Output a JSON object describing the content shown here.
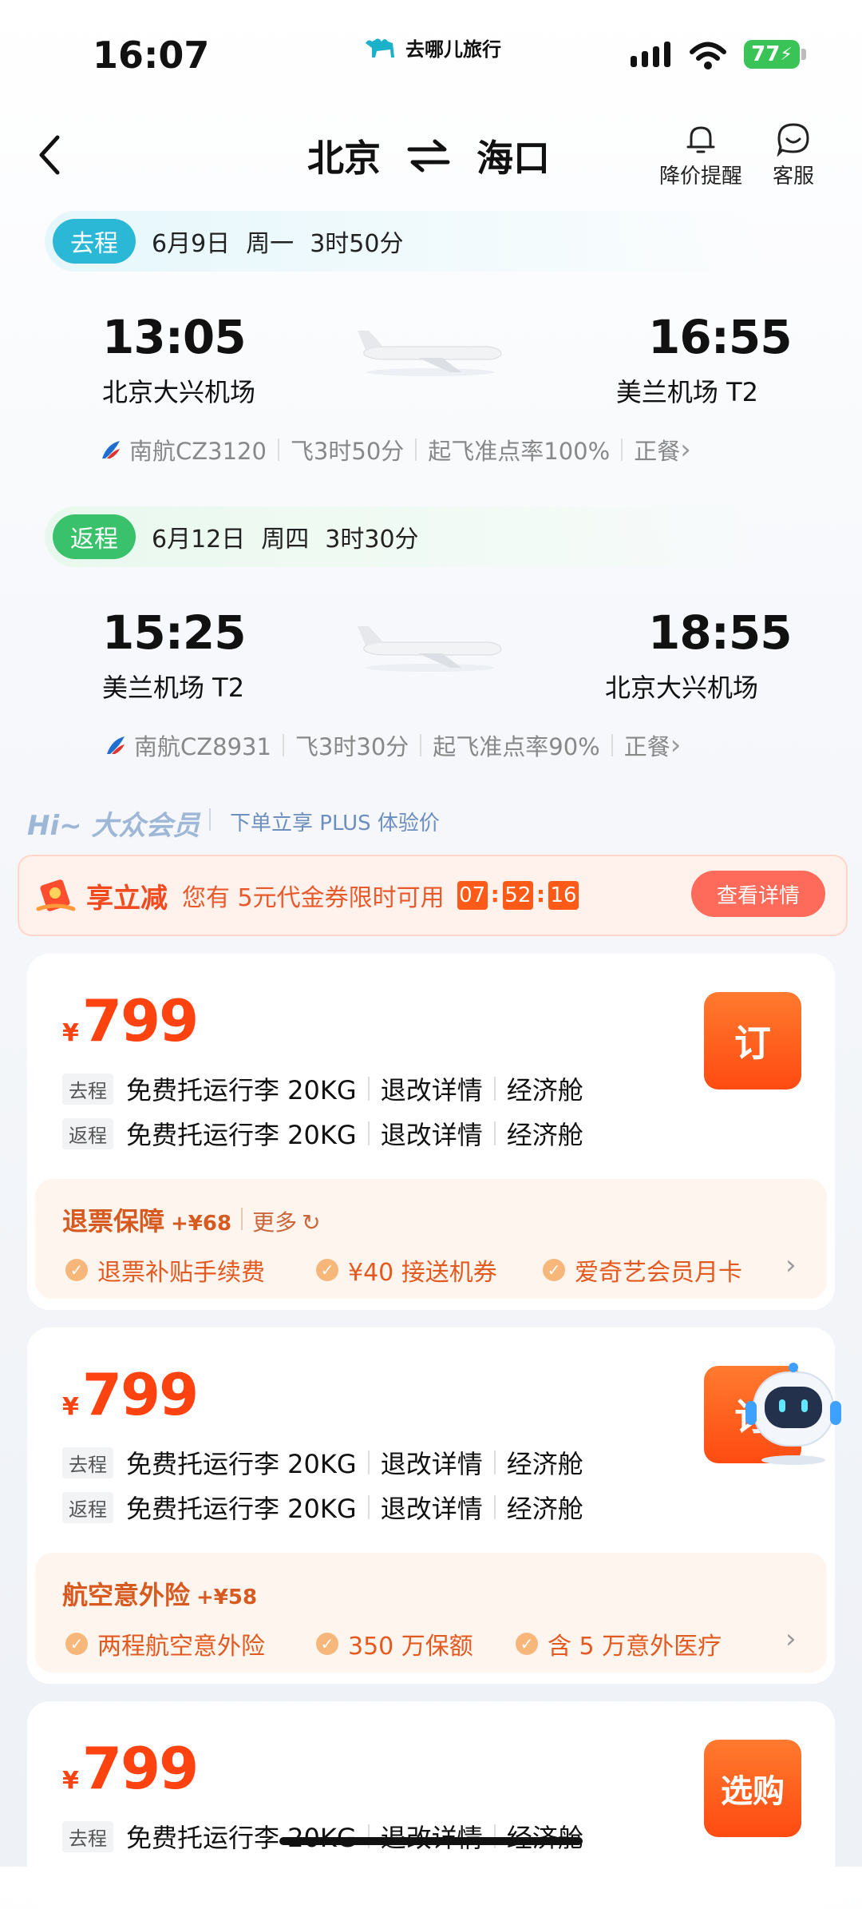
{
  "status": {
    "time": "16:07",
    "app_name": "去哪儿旅行",
    "battery": "77"
  },
  "header": {
    "from": "北京",
    "to": "海口",
    "price_alert": "降价提醒",
    "service": "客服"
  },
  "outbound": {
    "tag": "去程",
    "date": "6月9日",
    "weekday": "周一",
    "duration": "3时50分",
    "dep_time": "13:05",
    "dep_airport": "北京大兴机场",
    "arr_time": "16:55",
    "arr_airport": "美兰机场 T2",
    "flight": "南航CZ3120",
    "fly_time": "飞3时50分",
    "ontime": "起飞准点率100%",
    "meal": "正餐"
  },
  "return": {
    "tag": "返程",
    "date": "6月12日",
    "weekday": "周四",
    "duration": "3时30分",
    "dep_time": "15:25",
    "dep_airport": "美兰机场 T2",
    "arr_time": "18:55",
    "arr_airport": "北京大兴机场",
    "flight": "南航CZ8931",
    "fly_time": "飞3时30分",
    "ontime": "起飞准点率90%",
    "meal": "正餐"
  },
  "member": {
    "title": "Hi~ 大众会员",
    "subtitle": "下单立享 PLUS 体验价"
  },
  "coupon": {
    "title": "享立减",
    "text": "您有 5元代金券限时可用",
    "h": "07",
    "m": "52",
    "s": "16",
    "button": "查看详情"
  },
  "colors": {
    "accent": "#ff4310",
    "outbound_tag": "#2bb8d6",
    "return_tag": "#39c26b"
  },
  "cards": [
    {
      "currency": "¥",
      "price": "799",
      "button": "订",
      "rows": [
        {
          "tag": "去程",
          "baggage": "免费托运行李 20KG",
          "rules": "退改详情",
          "cabin": "经济舱"
        },
        {
          "tag": "返程",
          "baggage": "免费托运行李 20KG",
          "rules": "退改详情",
          "cabin": "经济舱"
        }
      ],
      "extra": {
        "title": "退票保障",
        "price": "+¥68",
        "more": "更多",
        "perks": [
          "退票补贴手续费",
          "¥40 接送机券",
          "爱奇艺会员月卡"
        ]
      }
    },
    {
      "currency": "¥",
      "price": "799",
      "button": "订",
      "rows": [
        {
          "tag": "去程",
          "baggage": "免费托运行李 20KG",
          "rules": "退改详情",
          "cabin": "经济舱"
        },
        {
          "tag": "返程",
          "baggage": "免费托运行李 20KG",
          "rules": "退改详情",
          "cabin": "经济舱"
        }
      ],
      "extra": {
        "title": "航空意外险",
        "price": "+¥58",
        "perks": [
          "两程航空意外险",
          "350 万保额",
          "含 5 万意外医疗"
        ]
      }
    },
    {
      "currency": "¥",
      "price": "799",
      "button": "选购",
      "rows": [
        {
          "tag": "去程",
          "baggage": "免费托运行李 20KG",
          "rules": "退改详情",
          "cabin": "经济舱"
        }
      ]
    }
  ]
}
